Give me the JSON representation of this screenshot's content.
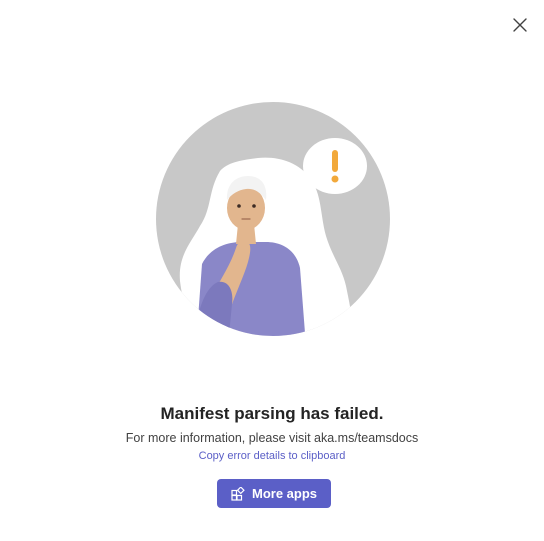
{
  "dialog": {
    "title": "Manifest parsing has failed.",
    "info": "For more information, please visit aka.ms/teamsdocs",
    "copy_link": "Copy error details to clipboard",
    "primary_button": {
      "label": "More apps",
      "icon": "apps-add-icon"
    },
    "close_icon": "close-icon"
  },
  "colors": {
    "accent": "#5b5fc7",
    "illustration_bg": "#c8c8c8",
    "warning": "#f2a93b"
  }
}
